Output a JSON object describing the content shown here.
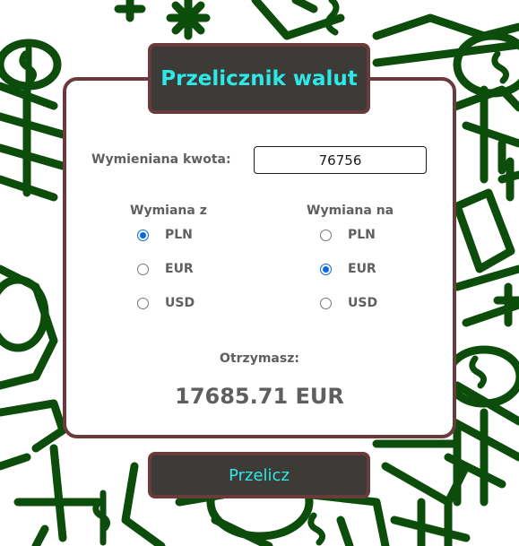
{
  "header": {
    "title": "Przelicznik walut"
  },
  "amount": {
    "label": "Wymieniana kwota:",
    "value": "76756"
  },
  "from": {
    "title": "Wymiana z",
    "selected": "PLN",
    "options": [
      "PLN",
      "EUR",
      "USD"
    ]
  },
  "to": {
    "title": "Wymiana na",
    "selected": "EUR",
    "options": [
      "PLN",
      "EUR",
      "USD"
    ]
  },
  "result": {
    "label": "Otrzymasz:",
    "value": "17685.71 EUR"
  },
  "convert_button": {
    "label": "Przelicz"
  },
  "colors": {
    "accent": "#2ee8e8",
    "panel_dark": "#3d3b37",
    "border": "#6b3a3a",
    "background_doodle": "#0c4d0c",
    "radio_selected": "#0a66e4"
  }
}
